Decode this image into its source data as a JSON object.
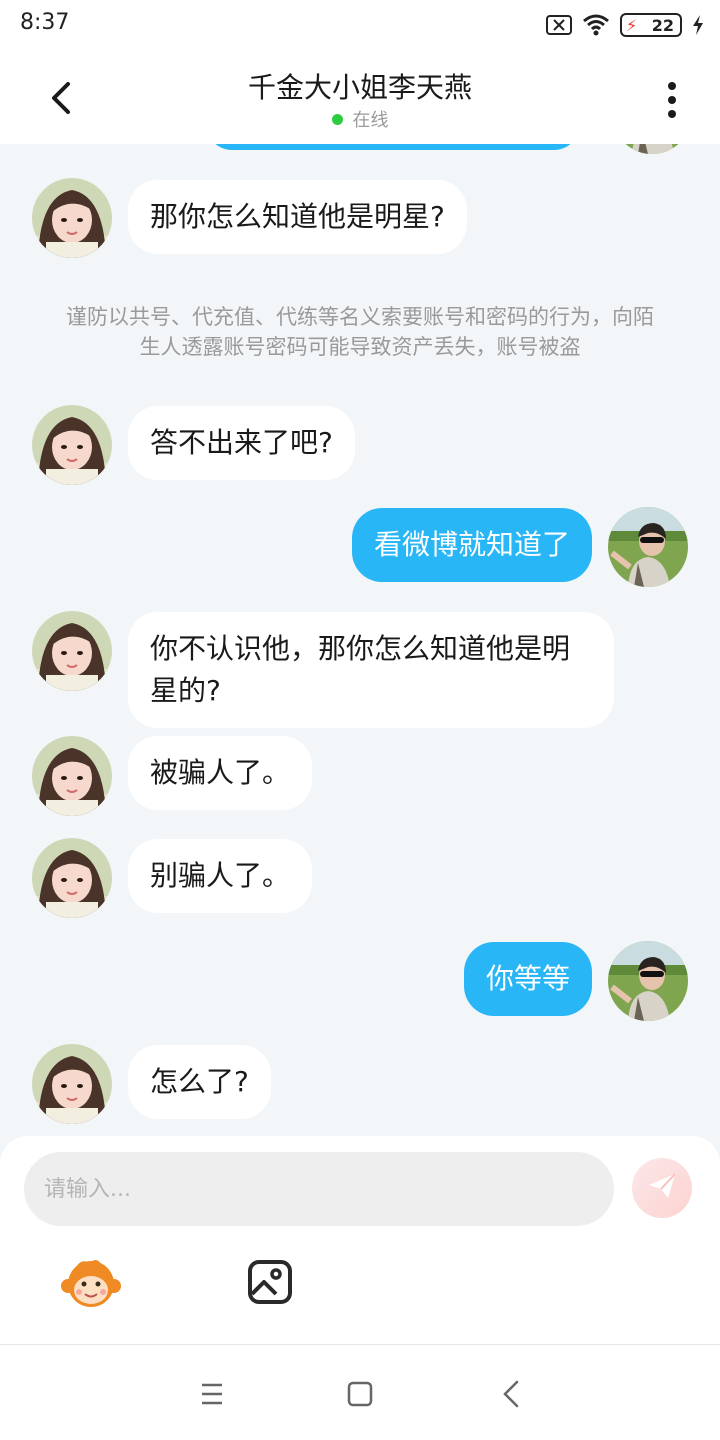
{
  "status_bar": {
    "time": "8:37",
    "battery": "22"
  },
  "header": {
    "title": "千金大小姐李天燕",
    "status": "在线"
  },
  "messages": [
    {
      "from": "them",
      "text": "那你怎么知道他是明星?"
    },
    {
      "type": "notice",
      "text": "谨防以共号、代充值、代练等名义索要账号和密码的行为，向陌生人透露账号密码可能导致资产丢失，账号被盗"
    },
    {
      "from": "them",
      "text": "答不出来了吧?"
    },
    {
      "from": "me",
      "text": "看微博就知道了"
    },
    {
      "from": "them",
      "text": "你不认识他，那你怎么知道他是明星的?"
    },
    {
      "from": "them",
      "text": "被骗人了。"
    },
    {
      "from": "them",
      "text": "别骗人了。"
    },
    {
      "from": "me",
      "text": "你等等"
    },
    {
      "from": "them",
      "text": "怎么了?"
    }
  ],
  "input": {
    "placeholder": "请输入..."
  },
  "icons": {
    "back": "chevron-left-icon",
    "more": "more-vertical-icon",
    "send": "paper-plane-icon",
    "emoji": "monkey-emoji-icon",
    "image": "image-icon"
  },
  "colors": {
    "accent": "#29b6f6",
    "online": "#2ecc40",
    "background": "#f3f6f8"
  }
}
